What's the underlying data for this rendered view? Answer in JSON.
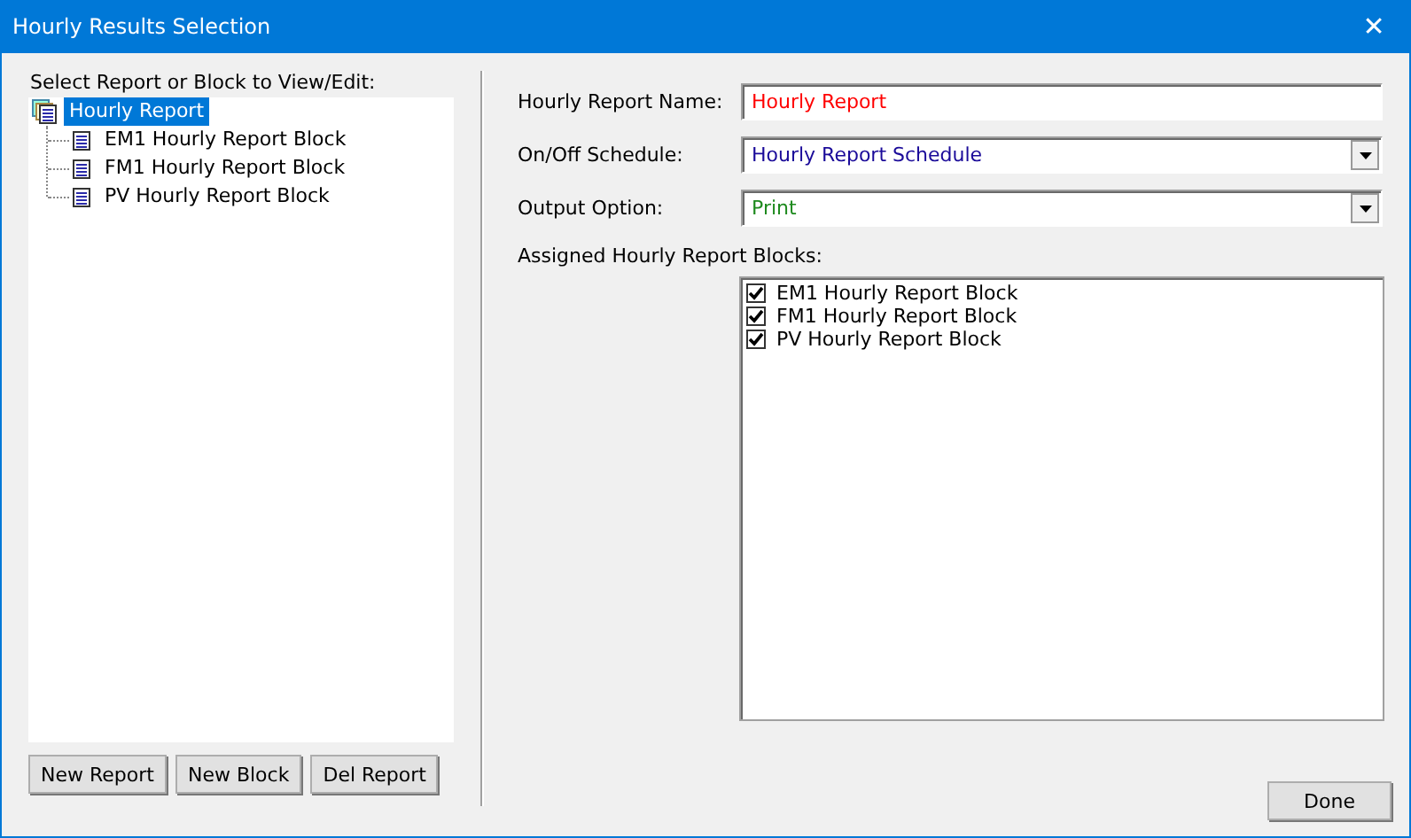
{
  "window": {
    "title": "Hourly Results Selection",
    "close": "✕"
  },
  "tree_label": "Select Report or Block to View/Edit:",
  "tree": [
    {
      "label": "Hourly Report",
      "selected": true,
      "children": [
        {
          "label": "EM1 Hourly Report Block",
          "selected": false
        },
        {
          "label": "FM1 Hourly Report Block",
          "selected": false
        },
        {
          "label": "PV Hourly Report Block",
          "selected": false
        }
      ]
    }
  ],
  "left_buttons": [
    "New Report",
    "New Block",
    "Del Report"
  ],
  "fields": [
    {
      "label": "Hourly Report Name:",
      "kind": "text",
      "value": "Hourly Report",
      "color": "#ff0000"
    },
    {
      "label": "On/Off Schedule:",
      "kind": "dropdown",
      "value": "Hourly Report Schedule",
      "color": "#1a0a99"
    },
    {
      "label": "Output Option:",
      "kind": "dropdown",
      "value": "Print",
      "color": "#1e8a1e"
    }
  ],
  "blocks_label": "Assigned Hourly Report Blocks:",
  "blocks": [
    {
      "label": "EM1 Hourly Report Block",
      "checked": true
    },
    {
      "label": "FM1 Hourly Report Block",
      "checked": true
    },
    {
      "label": "PV Hourly Report Block",
      "checked": true
    }
  ],
  "done_button": "Done"
}
